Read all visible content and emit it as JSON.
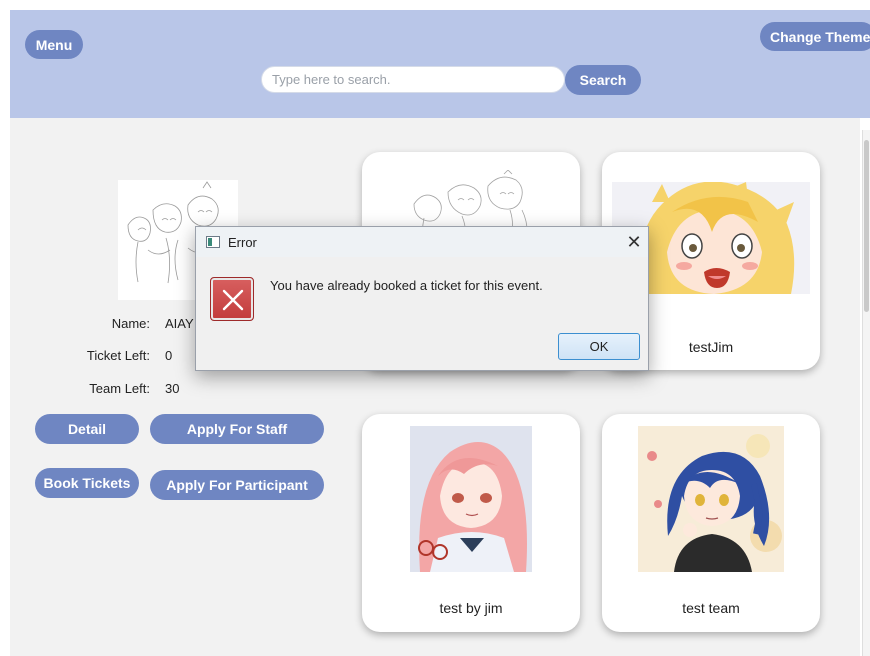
{
  "header": {
    "menu_label": "Menu",
    "theme_label": "Change Theme",
    "search_placeholder": "Type here to search.",
    "search_label": "Search"
  },
  "detail": {
    "name_label": "Name:",
    "name_value": "AIAY",
    "ticket_label": "Ticket Left:",
    "ticket_value": "0",
    "team_label": "Team Left:",
    "team_value": "30",
    "detail_btn": "Detail",
    "staff_btn": "Apply For Staff",
    "book_btn": "Book Tickets",
    "participant_btn": "Apply For Participant"
  },
  "cards": [
    {
      "title": ""
    },
    {
      "title": "testJim"
    },
    {
      "title": "test by jim"
    },
    {
      "title": "test team"
    }
  ],
  "dialog": {
    "title": "Error",
    "message": "You have already booked a ticket for this event.",
    "ok_label": "OK"
  },
  "colors": {
    "header_bg": "#b9c6e8",
    "button_bg": "#6f86c2",
    "error_red": "#c23b3b"
  }
}
